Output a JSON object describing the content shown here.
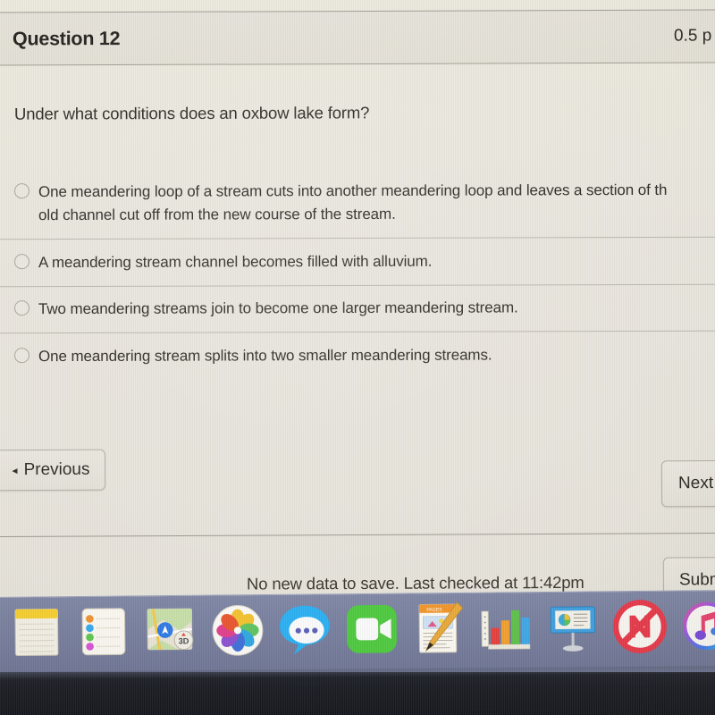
{
  "header": {
    "question_label": "Question 12",
    "points": "0.5 p"
  },
  "question": {
    "prompt": "Under what conditions does an oxbow lake form?",
    "options": [
      {
        "text": "One meandering loop of a stream cuts into another meandering loop and leaves a section of th",
        "selected": false
      },
      {
        "text": "A meandering stream channel becomes filled with alluvium.",
        "selected": false
      },
      {
        "text": "Two meandering streams join to become one larger meandering stream.",
        "selected": false
      },
      {
        "text": "One meandering stream splits into two smaller meandering streams.",
        "selected": false
      }
    ],
    "option_one_line_two": "old channel cut off from the new course of the stream."
  },
  "navigation": {
    "previous_label": "Previous",
    "previous_arrow": "◂",
    "next_label": "Next"
  },
  "status": {
    "save_message": "No new data to save. Last checked at 11:42pm",
    "submit_label": "Subm"
  },
  "dock": {
    "items": [
      {
        "name": "notes-icon",
        "label": "Notes"
      },
      {
        "name": "reminders-icon",
        "label": "Reminders"
      },
      {
        "name": "maps-icon",
        "label": "Maps"
      },
      {
        "name": "photos-icon",
        "label": "Photos"
      },
      {
        "name": "messages-icon",
        "label": "Messages"
      },
      {
        "name": "facetime-icon",
        "label": "FaceTime"
      },
      {
        "name": "pages-icon",
        "label": "Pages"
      },
      {
        "name": "numbers-icon",
        "label": "Numbers"
      },
      {
        "name": "keynote-icon",
        "label": "Keynote"
      },
      {
        "name": "news-icon",
        "label": "News"
      },
      {
        "name": "music-icon",
        "label": "Music"
      }
    ]
  },
  "colors": {
    "page_background": "#e8e5dd",
    "header_band": "#e4e1d8",
    "separator": "#b9b6ac",
    "text": "#2c2823",
    "dock_background": "#767d9c",
    "bezel": "#191b22"
  }
}
